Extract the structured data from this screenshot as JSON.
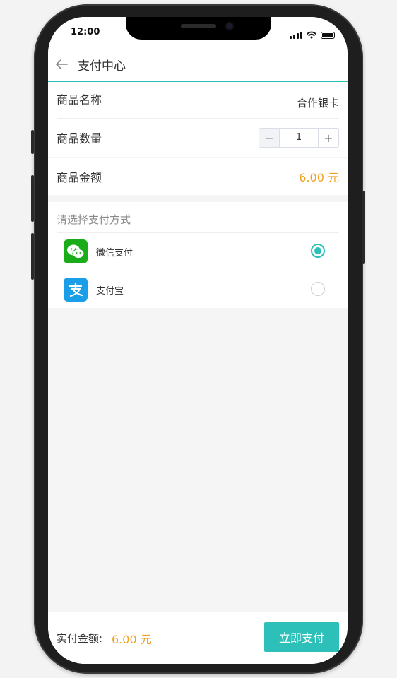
{
  "status_bar": {
    "time": "12:00"
  },
  "header": {
    "title": "支付中心"
  },
  "product": {
    "name_label": "商品名称",
    "name_value": "合作银卡",
    "quantity_label": "商品数量",
    "quantity_minus": "−",
    "quantity_value": "1",
    "quantity_plus": "+",
    "amount_label": "商品金额",
    "amount_value": "6.00 元"
  },
  "payment": {
    "section_title": "请选择支付方式",
    "options": [
      {
        "label": "微信支付",
        "icon": "wechat-pay-icon",
        "selected": true
      },
      {
        "label": "支付宝",
        "icon": "alipay-icon",
        "selected": false
      }
    ]
  },
  "footer": {
    "total_label": "实付金额:",
    "total_value": "6.00 元",
    "pay_button": "立即支付"
  },
  "colors": {
    "accent": "#2cc0b8",
    "price": "#f0a020",
    "wechat": "#1aad19",
    "alipay": "#1b9ee8"
  }
}
